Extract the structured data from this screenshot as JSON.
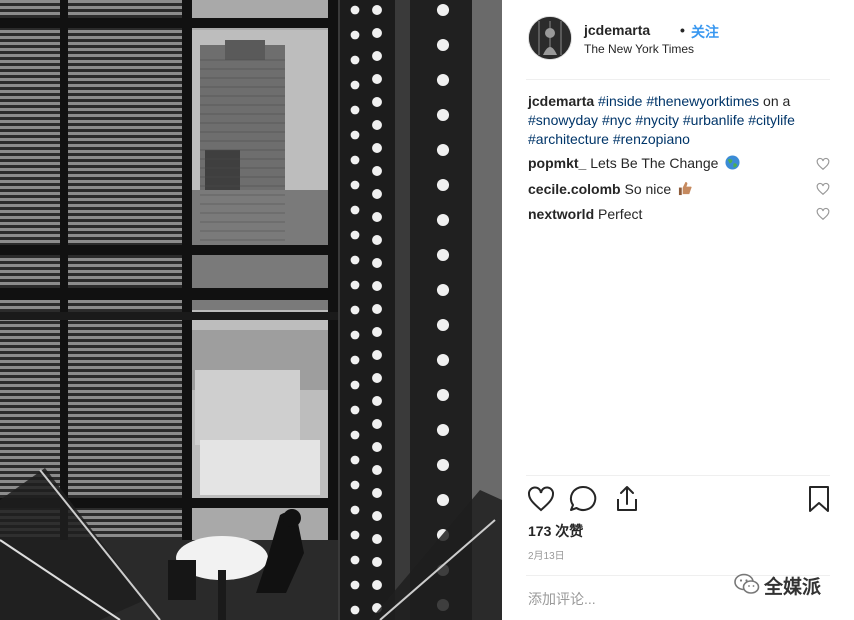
{
  "post": {
    "username": "jcdemarta",
    "separator": "•",
    "follow_label": "关注",
    "location": "The New York Times",
    "caption": {
      "user": "jcdemarta",
      "parts": [
        {
          "text": "#inside",
          "tag": true
        },
        {
          "text": " ",
          "tag": false
        },
        {
          "text": "#thenewyorktimes",
          "tag": true
        },
        {
          "text": " on a ",
          "tag": false
        },
        {
          "text": "#snowyday",
          "tag": true
        },
        {
          "text": " ",
          "tag": false
        },
        {
          "text": "#nyc",
          "tag": true
        },
        {
          "text": " ",
          "tag": false
        },
        {
          "text": "#nycity",
          "tag": true
        },
        {
          "text": " ",
          "tag": false
        },
        {
          "text": "#urbanlife",
          "tag": true
        },
        {
          "text": " ",
          "tag": false
        },
        {
          "text": "#citylife",
          "tag": true
        },
        {
          "text": " ",
          "tag": false
        },
        {
          "text": "#architecture",
          "tag": true
        },
        {
          "text": " ",
          "tag": false
        },
        {
          "text": "#renzopiano",
          "tag": true
        }
      ]
    },
    "comments": [
      {
        "user": "popmkt_",
        "text": "Lets Be The Change",
        "emoji": "globe"
      },
      {
        "user": "cecile.colomb",
        "text": "So nice",
        "emoji": "thumbs-up"
      },
      {
        "user": "nextworld",
        "text": "Perfect",
        "emoji": ""
      }
    ],
    "likes": "173 次赞",
    "date": "2月13日",
    "add_comment_placeholder": "添加评论..."
  },
  "icons": {
    "like": "heart-icon",
    "comment": "comment-icon",
    "share": "share-icon",
    "save": "bookmark-icon",
    "comment_like": "heart-icon"
  },
  "watermark": {
    "text": "全媒派"
  },
  "colors": {
    "link": "#3897f0",
    "hashtag": "#003569",
    "muted": "#999999",
    "text": "#262626"
  }
}
